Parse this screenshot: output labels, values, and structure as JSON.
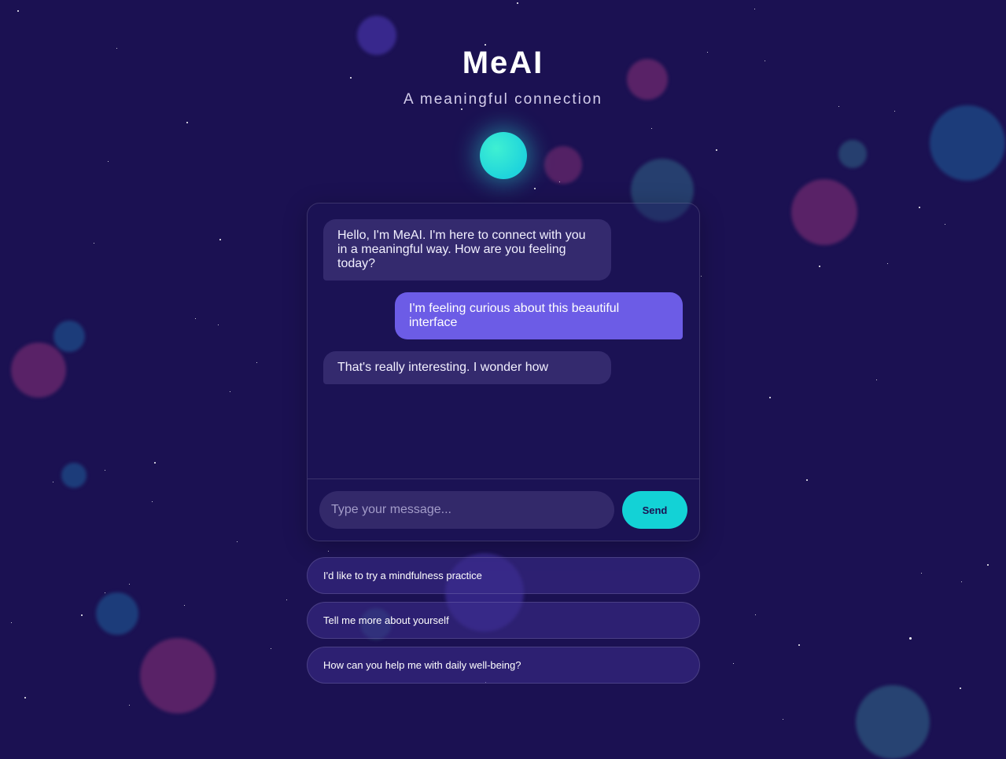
{
  "header": {
    "title": "MeAI",
    "subtitle": "A meaningful connection"
  },
  "chat": {
    "messages": [
      {
        "role": "ai",
        "text": "Hello, I'm MeAI. I'm here to connect with you in a meaningful way. How are you feeling today?"
      },
      {
        "role": "user",
        "text": "I'm feeling curious about this beautiful interface"
      },
      {
        "role": "ai",
        "text": "That's really interesting. I wonder how"
      }
    ],
    "input_placeholder": "Type your message...",
    "send_label": "Send"
  },
  "suggestions": [
    "I'd like to try a mindfulness practice",
    "Tell me more about yourself",
    "How can you help me with daily well-being?"
  ],
  "colors": {
    "background": "#1b1152",
    "accent": "#13d2d6",
    "user_bubble": "#6c5ce6",
    "ai_bubble": "#342a6e"
  }
}
